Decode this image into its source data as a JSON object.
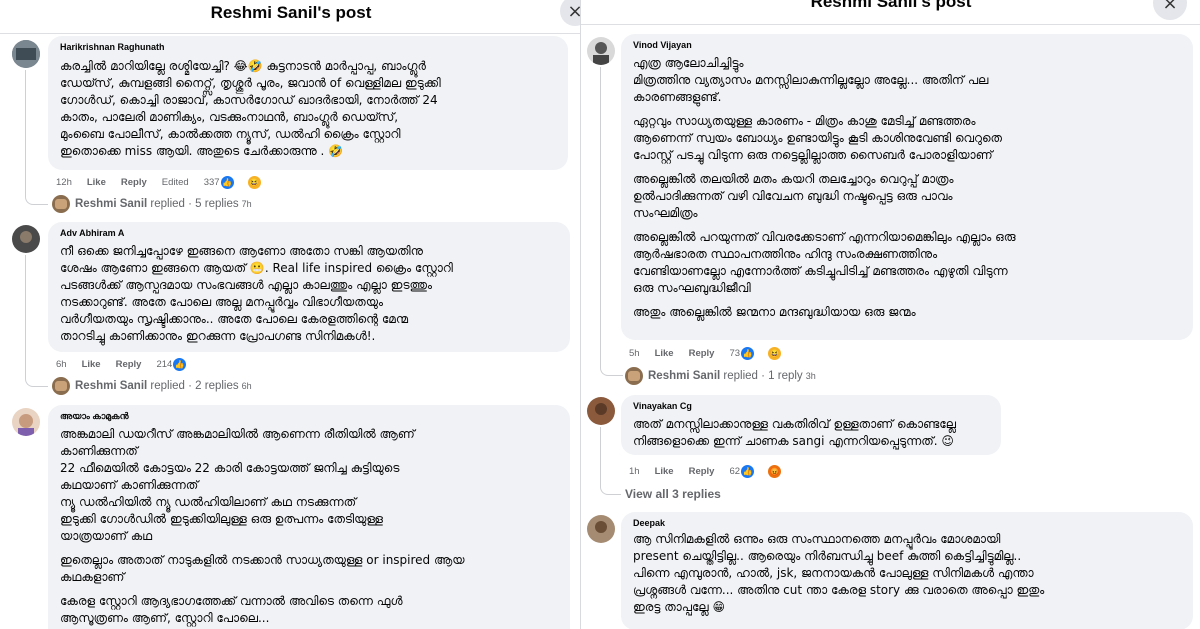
{
  "left": {
    "title": "Reshmi Sanil's post",
    "comments": [
      {
        "author": "Harikrishnan Raghunath",
        "lines": [
          "കരച്ചിൽ മാറിയില്ലേ രശ്മിയേച്ചി? 😂🤣 കുട്ടനാടൻ മാർപ്പാപ്പ, ബാംഗ്ലൂർ",
          "ഡേയ്സ്, കുമ്പളങ്ങി നൈറ്റ്സ്, തൃശ്ശൂർ പൂരം, ജവാൻ of വെള്ളിമല ഇടുക്കി",
          "ഗോൾഡ്, കൊച്ചി രാജാവ്, കാസർഗോഡ് ഖാദർഭായി, നോർത്ത് 24",
          "കാതം, പാലേരി മാണിക്യം, വടക്കുംനാഥൻ, ബാംഗ്ലൂർ ഡെയ്സ്,",
          "മുംബൈ പോലീസ്, കാൽക്കത്ത ന്യൂസ്, ഡൽഹി ക്രൈം സ്റ്റോറി",
          "ഇതൊക്കെ miss ആയി. അതുടെ ചേർക്കാരുന്നു . 🤣"
        ],
        "time": "12h",
        "like": "Like",
        "reply": "Reply",
        "edited": "Edited",
        "reactions": "337",
        "replied_name": "Reshmi Sanil",
        "replied_text": "replied · 5 replies",
        "replied_time": "7h"
      },
      {
        "author": "Adv Abhiram A",
        "lines": [
          "നീ ഒക്കെ ജനിച്ചപ്പോഴേ ഇങ്ങനെ ആണോ അതോ സങ്കി ആയതിനു",
          "ശേഷം ആണോ ഇങ്ങനെ ആയത് 😬. Real life inspired ക്രൈം സ്റ്റോറി",
          "പടങ്ങൾക്ക് ആസ്പദമായ സംഭവങ്ങൾ എല്ലാ കാലത്തും എല്ലാ ഇടത്തും",
          "നടക്കാറുണ്ട്. അതേ പോലെ അല്ല മനപ്പൂർവ്വം വിഭാഗീയതയും",
          "വർഗീയതയും സൃഷ്ടിക്കാനും.. അതേ പോലെ കേരളത്തിന്റെ മേന്മ",
          "താറടിച്ചു കാണിക്കാനും ഇറക്കുന്ന പ്രോപഗണ്ട സിനിമകൾ!."
        ],
        "time": "6h",
        "like": "Like",
        "reply": "Reply",
        "reactions": "214",
        "replied_name": "Reshmi Sanil",
        "replied_text": "replied · 2 replies",
        "replied_time": "6h"
      },
      {
        "author": "അയാം കാമുകൻ",
        "paragraphs": [
          [
            "അങ്കമാലി ഡയറീസ് അങ്കമാലിയിൽ ആണെന്ന രീതിയിൽ ആണ്",
            "കാണിക്കുന്നത്",
            "22 ഫീമെയിൽ കോട്ടയം 22 കാരി കോട്ടയത്ത് ജനിച്ച കുട്ടിയുടെ",
            "കഥയാണ് കാണിക്കുന്നത്",
            "ന്യൂ ഡൽഹിയിൽ ന്യൂ ഡൽഹിയിലാണ് കഥ നടക്കുന്നത്",
            "ഇടുക്കി ഗോൾഡിൽ ഇടുക്കിയിലുള്ള ഒരു ഉത്പന്നം തേടിയുള്ള",
            "യാത്രയാണ് കഥ"
          ],
          [
            "ഇതെല്ലാം അതാത് നാടുകളിൽ നടക്കാൻ സാധ്യതയുള്ള or inspired ആയ",
            "കഥകളാണ്"
          ],
          [
            "കേരള സ്റ്റോറി ആദ്യഭാഗത്തേക്ക് വന്നാൽ അവിടെ തന്നെ ഫുൾ",
            "ആസൂത്രണം ആണ്, സ്റ്റോറി പോലെ..."
          ]
        ]
      }
    ]
  },
  "right": {
    "title": "Reshmi Sanil's post",
    "close_icon": "×",
    "comments": [
      {
        "author": "Vinod Vijayan",
        "paragraphs": [
          [
            "എത്ര ആലോചിച്ചിട്ടും",
            "മിത്രത്തിനു വ്യത്യാസം മനസ്സിലാകുന്നില്ലല്ലോ അല്ലേ... അതിന് പല",
            "കാരണങ്ങളുണ്ട്."
          ],
          [
            "ഏറ്റവും സാധ്യതയുള്ള കാരണം - മിത്രം കാശു മേടിച്ച് മണ്ടത്തരം",
            "ആണെന്ന് സ്വയം ബോധ്യം ഉണ്ടായിട്ടും കൂടി കാശിനുവേണ്ടി വെറുതെ",
            "പോസ്റ്റ് പടച്ചു വിടുന്ന ഒരു നട്ടെല്ലില്ലാത്ത സൈബർ പോരാളിയാണ്"
          ],
          [
            "അല്ലെങ്കിൽ തലയിൽ മതം കയറി തലച്ചോറും വെറുപ്പ് മാത്രം",
            "ഉൽപാദിക്കുന്നത് വഴി വിവേചന ബുദ്ധി നഷ്ടപ്പെട്ട ഒരു പാവം",
            "സംഘമിത്രം"
          ],
          [
            "അല്ലെങ്കിൽ പറയുന്നത് വിവരക്കേടാണ് എന്നറിയാമെങ്കിലും എല്ലാം ഒരു",
            "ആർഷഭാരത സ്ഥാപനത്തിനും ഹിന്ദു സംരക്ഷണത്തിനും",
            "വേണ്ടിയാണല്ലോ എന്നോർത്ത് കടിച്ചുപിടിച്ച് മണ്ടത്തരം എഴുതി വിടുന്ന",
            "ഒരു സംഘബുദ്ധിജീവി"
          ],
          [
            "അതും അല്ലെങ്കിൽ ജന്മനാ മന്ദബുദ്ധിയായ ഒരു ജന്മം"
          ]
        ],
        "time": "5h",
        "like": "Like",
        "reply": "Reply",
        "reactions": "73",
        "replied_name": "Reshmi Sanil",
        "replied_text": "replied · 1 reply",
        "replied_time": "3h"
      },
      {
        "author": "Vinayakan Cg",
        "lines": [
          "അത് മനസ്സിലാക്കാനുള്ള വകതിരിവ് ഉള്ളതാണ് കൊണ്ടല്ലേ",
          "നിങ്ങളൊക്കെ ഇന്ന് ചാണക sangi എന്നറിയപ്പെടുന്നത്. 😉"
        ],
        "time": "1h",
        "like": "Like",
        "reply": "Reply",
        "reactions": "62",
        "view_all": "View all 3 replies"
      },
      {
        "author": "Deepak",
        "lines": [
          "ആ സിനിമകളിൽ ഒന്നും ഒരു സംസ്ഥാനത്തെ മനപ്പൂർവം മോശമായി",
          "present ചെയ്തിട്ടില്ല.. ആരെയും നിർബന്ധിച്ചു beef കുത്തി കെട്ടിച്ചിട്ടുമില്ല..",
          "പിന്നെ എമ്പുരാൻ, ഹാൽ, jsk, ജനനായകൻ പോലുള്ള സിനിമകൾ എന്താ",
          "പ്രശ്നങ്ങൾ വന്നേ... അതിനു cut ന്താ കേരള story ക്കു വരാതെ അപ്പൊ ഇതും",
          "ഇരട്ട താപ്പല്ലേ 😁"
        ]
      }
    ]
  },
  "icons": {
    "avatar": "avatar-icon",
    "like_reaction": "like-reaction-icon",
    "haha_reaction": "haha-reaction-icon",
    "angry_reaction": "angry-reaction-icon",
    "close": "close-icon"
  },
  "colors": {
    "bubble": "#f0f2f5",
    "meta_text": "#65676b",
    "like_blue": "#1877f2"
  }
}
